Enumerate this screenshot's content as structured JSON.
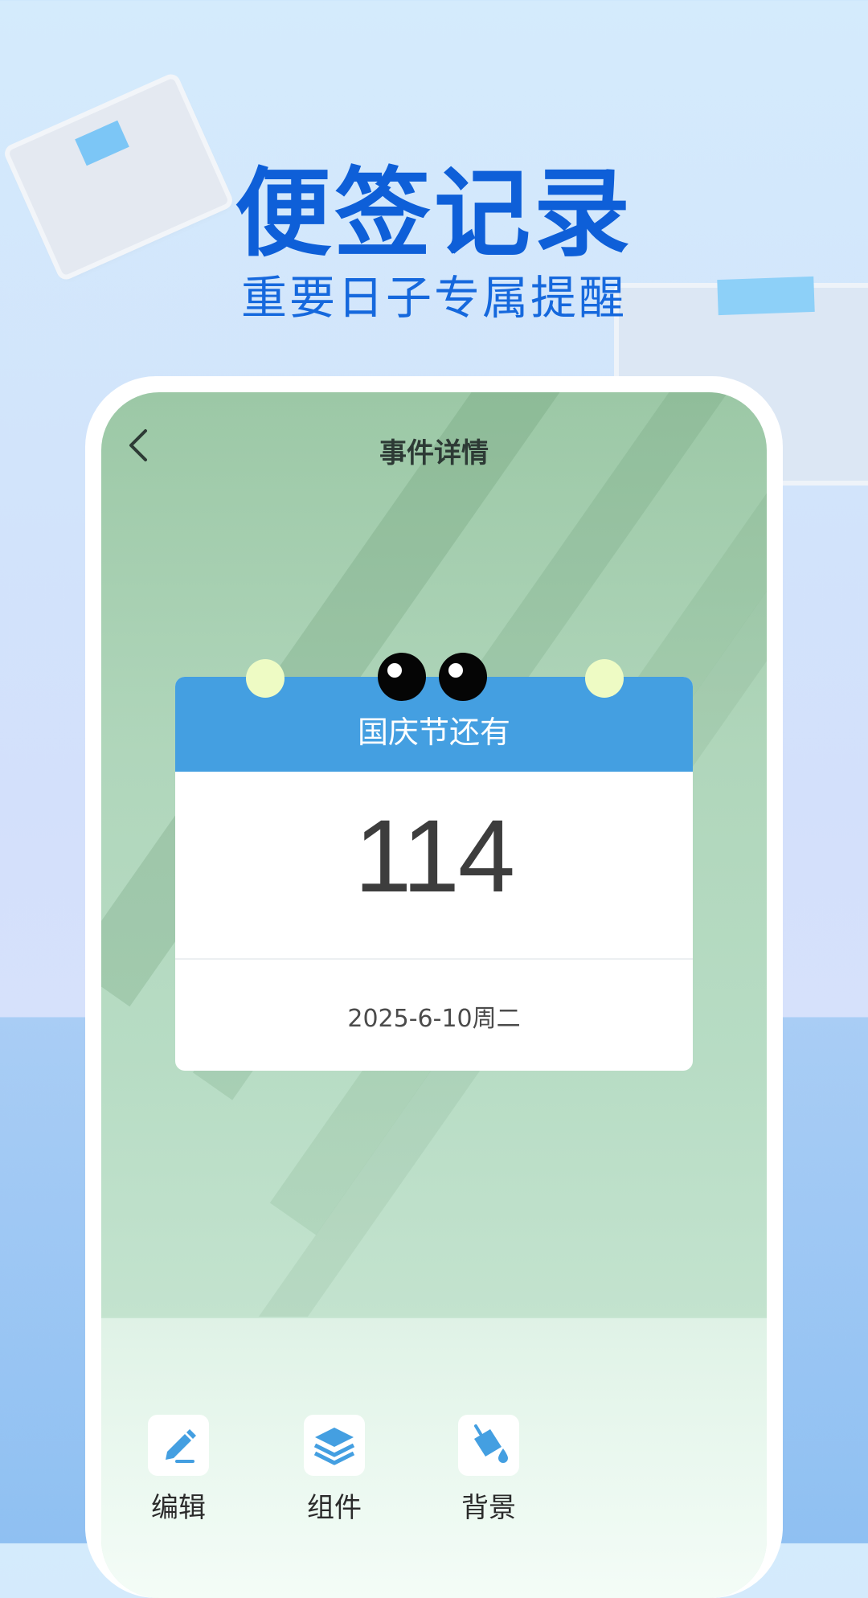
{
  "promo": {
    "headline": "便签记录",
    "subline": "重要日子专属提醒"
  },
  "screen": {
    "title": "事件详情",
    "back_icon": "chevron-left-icon"
  },
  "event_card": {
    "header": "国庆节还有",
    "days": "114",
    "date": "2025-6-10周二",
    "header_color": "#449fe1"
  },
  "toolbar": {
    "items": [
      {
        "label": "编辑",
        "icon": "pencil-icon"
      },
      {
        "label": "组件",
        "icon": "layers-icon"
      },
      {
        "label": "背景",
        "icon": "paint-bucket-icon"
      }
    ],
    "icon_color": "#449fe1"
  },
  "colors": {
    "headline": "#0e5fd8",
    "accent": "#449fe1"
  }
}
